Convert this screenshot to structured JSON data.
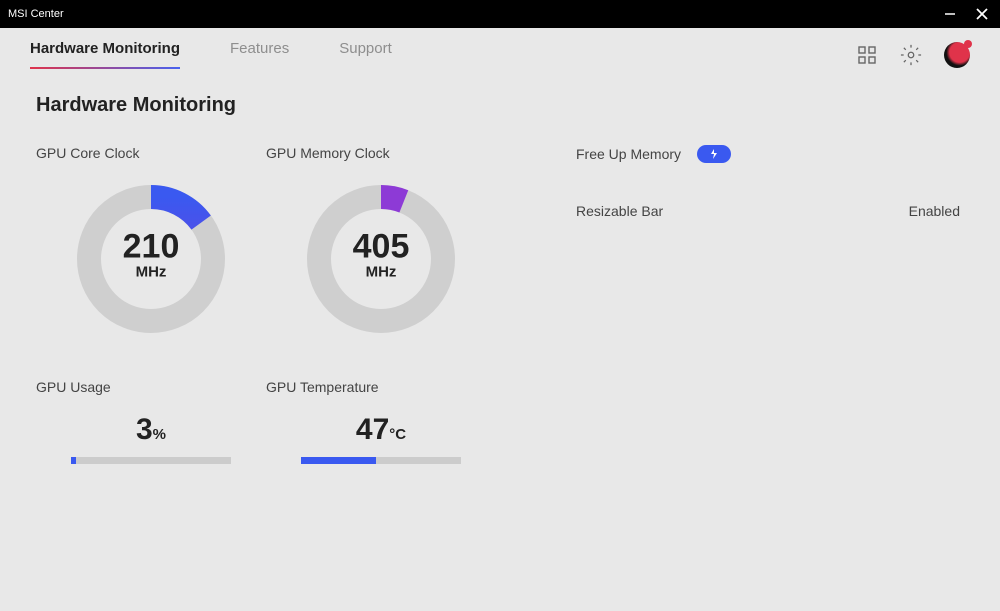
{
  "app_title": "MSI Center",
  "tabs": {
    "t0": "Hardware Monitoring",
    "t1": "Features",
    "t2": "Support"
  },
  "page_title": "Hardware Monitoring",
  "metrics": {
    "gpu_core_clock": {
      "label": "GPU Core Clock",
      "value": "210",
      "unit": "MHz",
      "pct": 15
    },
    "gpu_mem_clock": {
      "label": "GPU Memory Clock",
      "value": "405",
      "unit": "MHz",
      "pct": 6
    },
    "gpu_usage": {
      "label": "GPU Usage",
      "value": "3",
      "unit": "%",
      "pct": 3
    },
    "gpu_temp": {
      "label": "GPU Temperature",
      "value": "47",
      "unit": "°C",
      "pct": 47
    }
  },
  "right": {
    "free_up_label": "Free Up Memory",
    "resizable_bar_label": "Resizable Bar",
    "resizable_bar_value": "Enabled"
  }
}
